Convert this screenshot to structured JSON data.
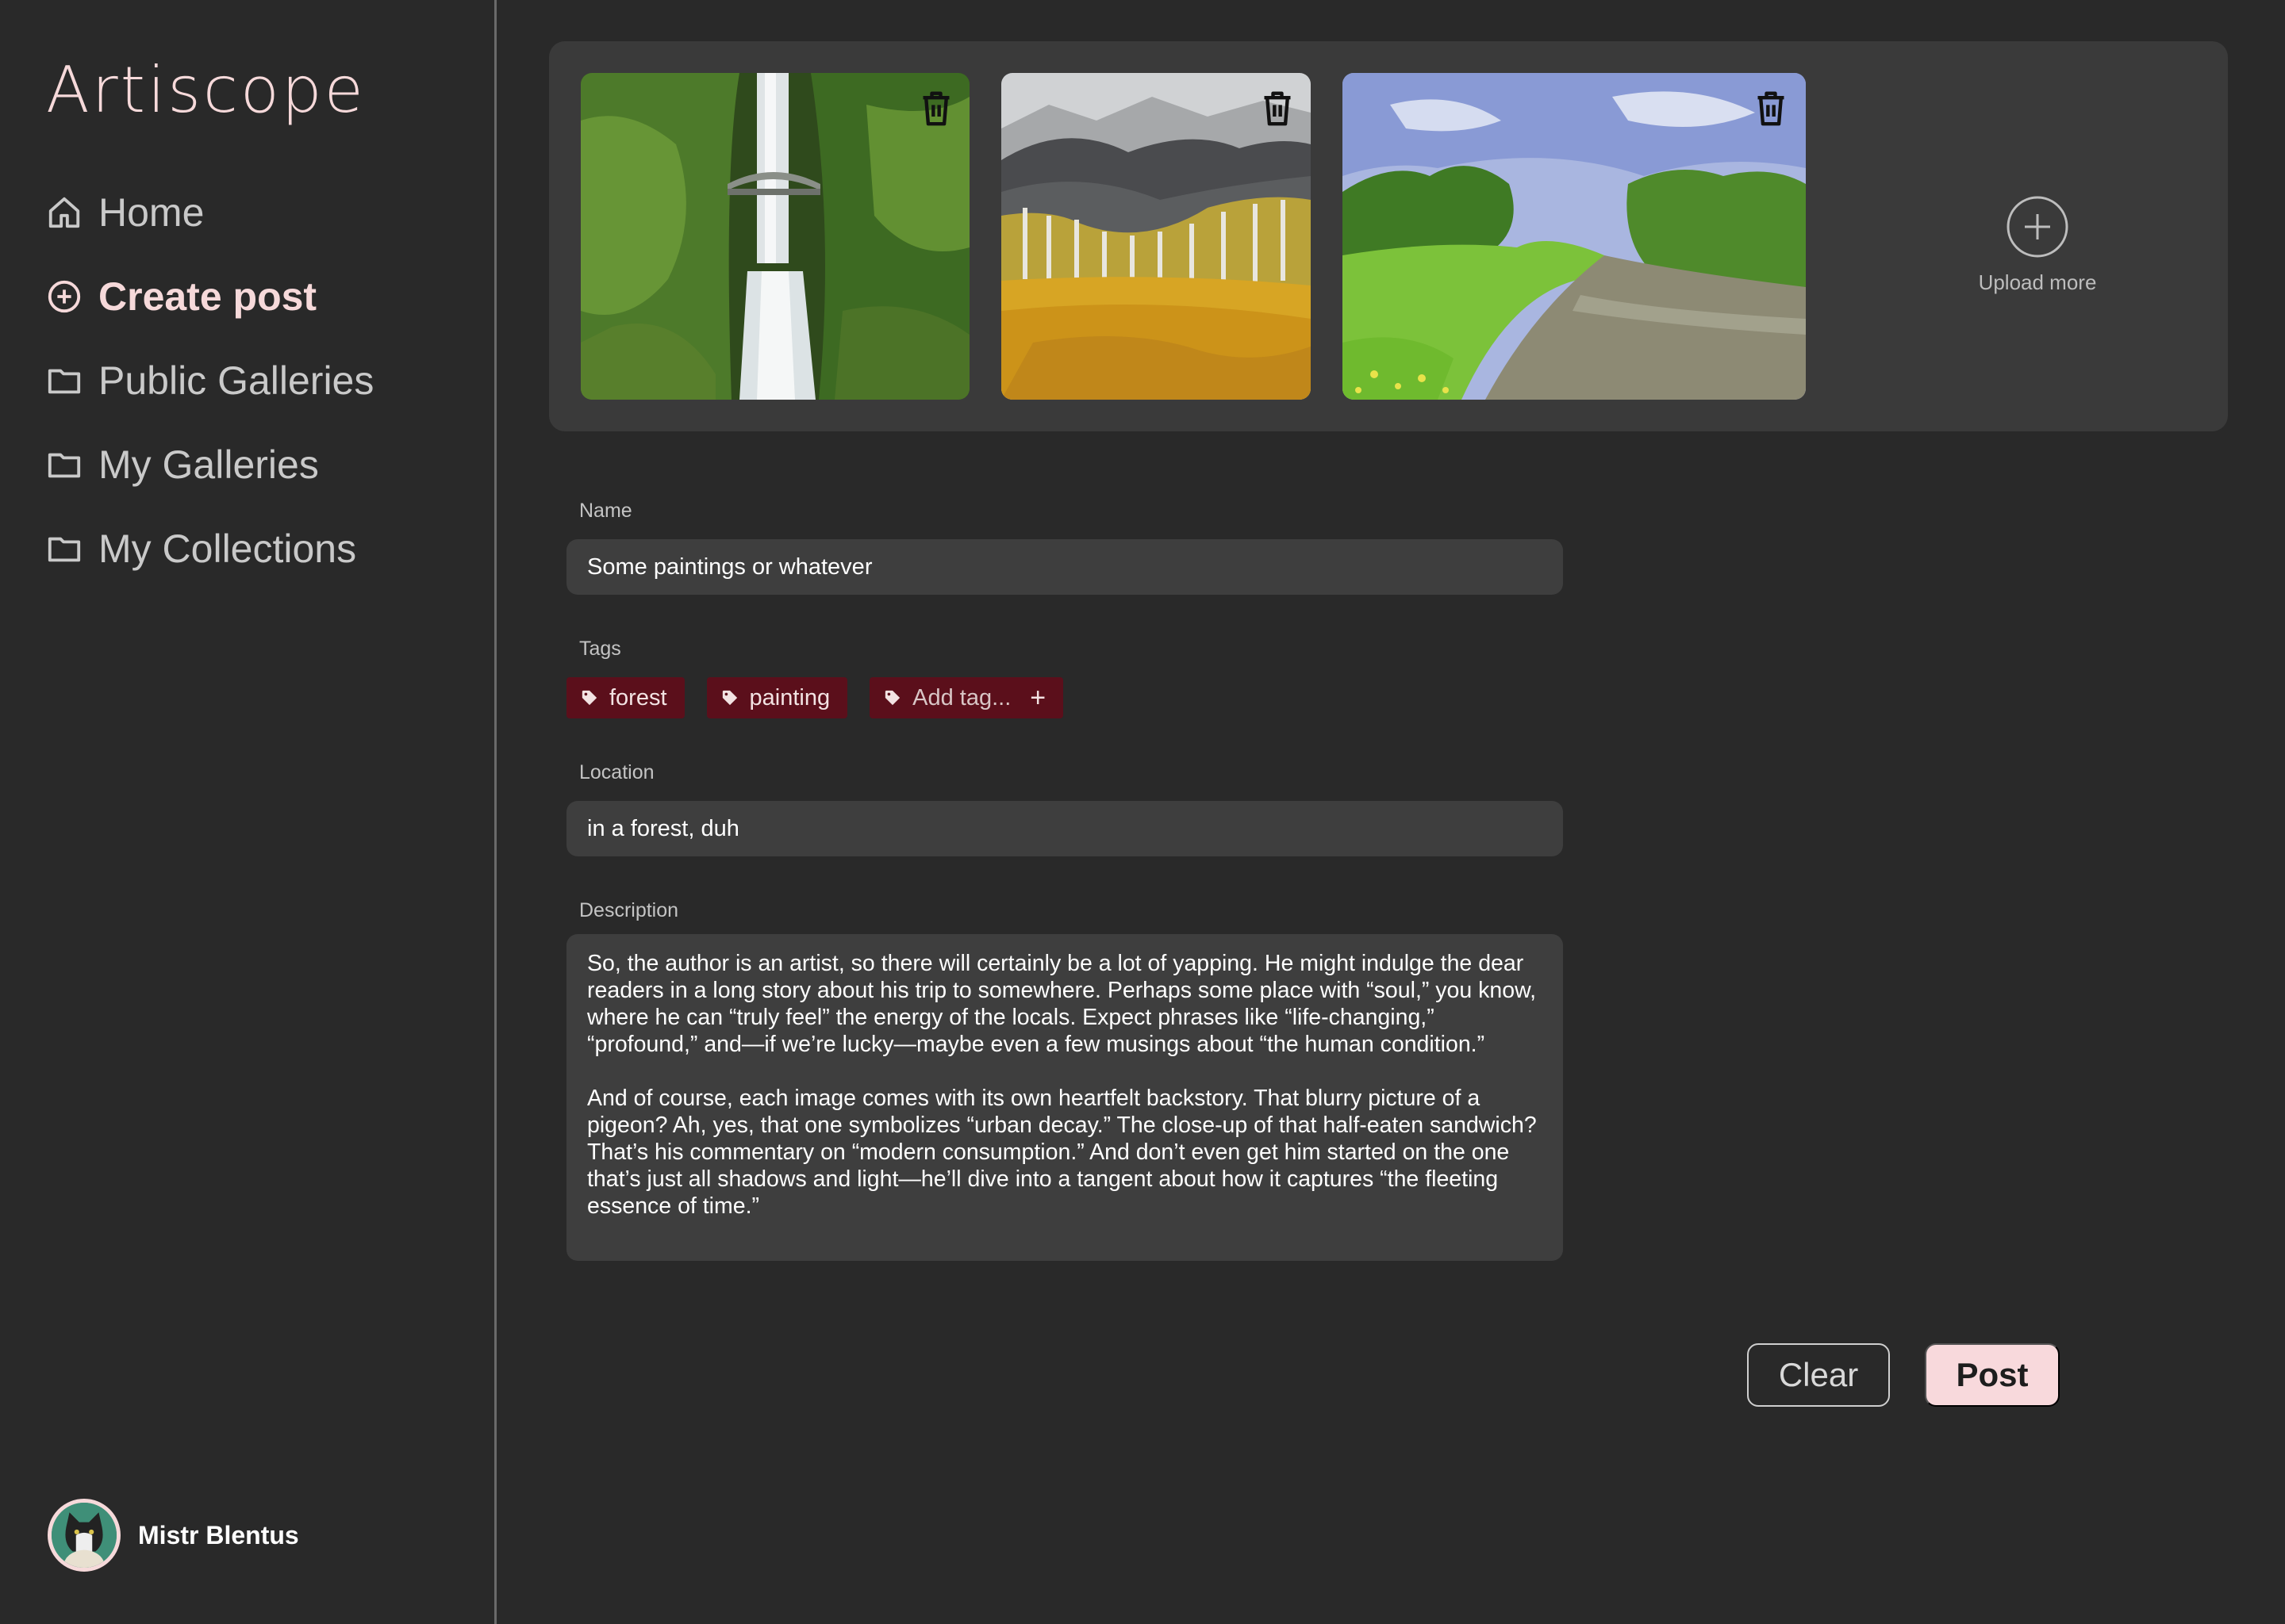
{
  "brand": "Artiscope",
  "nav": [
    {
      "label": "Home",
      "icon": "home-icon"
    },
    {
      "label": "Create post",
      "icon": "plus-circle-icon",
      "active": true
    },
    {
      "label": "Public Galleries",
      "icon": "folder-icon"
    },
    {
      "label": "My Galleries",
      "icon": "folder-icon"
    },
    {
      "label": "My Collections",
      "icon": "folder-icon"
    }
  ],
  "user": {
    "name": "Mistr Blentus"
  },
  "gallery": {
    "images": [
      {
        "subject": "waterfall with bridge in green gorge"
      },
      {
        "subject": "painting of birch trees and yellow meadow"
      },
      {
        "subject": "painting of river through green meadow"
      }
    ],
    "upload_label": "Upload more"
  },
  "form": {
    "name_label": "Name",
    "name_value": "Some paintings or whatever",
    "tags_label": "Tags",
    "tags": [
      "forest",
      "painting"
    ],
    "add_tag_placeholder": "Add tag...",
    "add_tag_symbol": "+",
    "location_label": "Location",
    "location_value": "in a forest, duh",
    "description_label": "Description",
    "description_value": "So, the author is an artist, so there will certainly be a lot of yapping. He might indulge the dear readers in a long story about his trip to somewhere. Perhaps some place with “soul,” you know, where he can “truly feel” the energy of the locals. Expect phrases like “life-changing,” “profound,” and—if we’re lucky—maybe even a few musings about “the human condition.”\n\nAnd of course, each image comes with its own heartfelt backstory. That blurry picture of a pigeon? Ah, yes, that one symbolizes “urban decay.” The close-up of that half-eaten sandwich? That’s his commentary on “modern consumption.” And don’t even get him started on the one that’s just all shadows and light—he’ll dive into a tangent about how it captures “the fleeting essence of time.”"
  },
  "actions": {
    "clear_label": "Clear",
    "post_label": "Post"
  },
  "colors": {
    "background": "#292929",
    "accent_pink": "#f6d9da",
    "tag_bg": "#5b0f1b",
    "field_bg": "#3e3e3e"
  }
}
